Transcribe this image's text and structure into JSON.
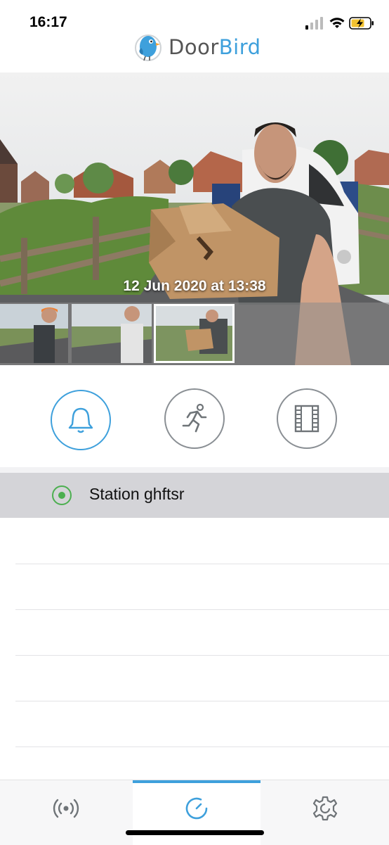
{
  "status_bar": {
    "time": "16:17"
  },
  "header": {
    "title_part1": "Door",
    "title_part2": "Bird",
    "brand_color": "#3ea0dc"
  },
  "camera": {
    "timestamp": "12 Jun 2020 at 13:38",
    "thumbnails": [
      {
        "name": "history-thumbnail-1",
        "selected": false
      },
      {
        "name": "history-thumbnail-2",
        "selected": false
      },
      {
        "name": "history-thumbnail-3",
        "selected": true
      },
      {
        "name": "history-thumbnail-4",
        "selected": false
      }
    ]
  },
  "actions": [
    {
      "icon": "bell-icon",
      "active": true
    },
    {
      "icon": "running-person-icon",
      "active": false
    },
    {
      "icon": "film-icon",
      "active": false
    }
  ],
  "station": {
    "name": "Station ghftsr",
    "status_color": "#4caf50"
  },
  "tabs": [
    {
      "icon": "broadcast-icon",
      "selected": false
    },
    {
      "icon": "history-clock-icon",
      "selected": true
    },
    {
      "icon": "gear-icon",
      "selected": false
    }
  ]
}
